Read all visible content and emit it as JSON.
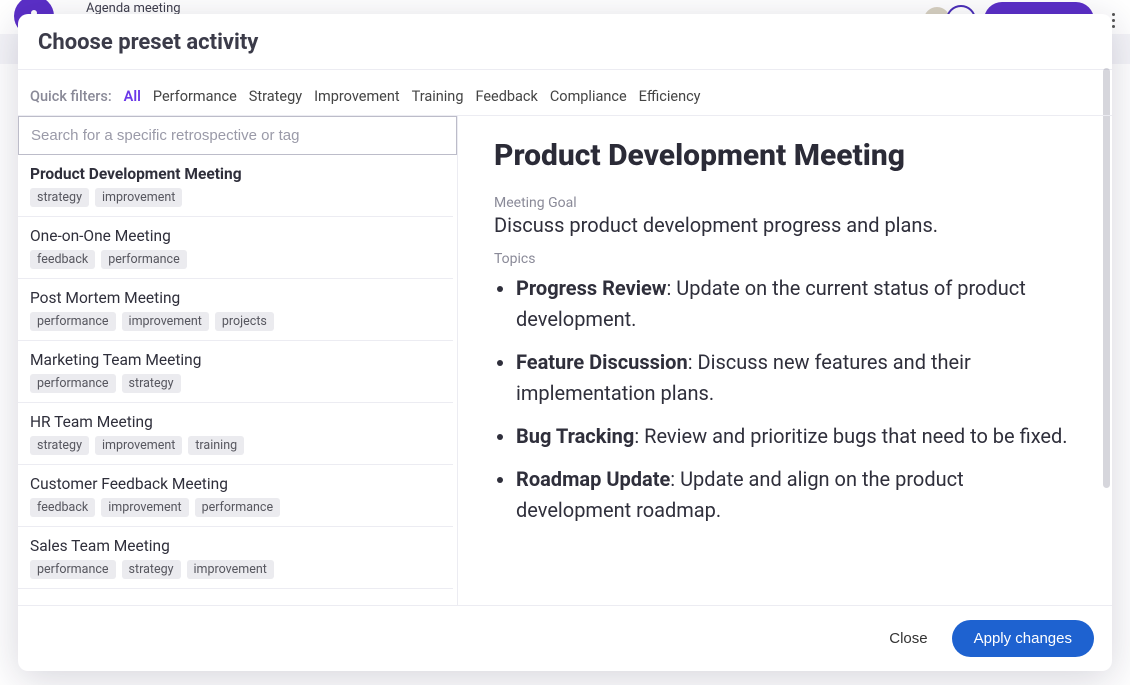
{
  "background": {
    "breadcrumb": "Agenda meeting"
  },
  "modal": {
    "title": "Choose preset activity",
    "filters_label": "Quick filters:",
    "filters": [
      {
        "label": "All",
        "active": true
      },
      {
        "label": "Performance",
        "active": false
      },
      {
        "label": "Strategy",
        "active": false
      },
      {
        "label": "Improvement",
        "active": false
      },
      {
        "label": "Training",
        "active": false
      },
      {
        "label": "Feedback",
        "active": false
      },
      {
        "label": "Compliance",
        "active": false
      },
      {
        "label": "Efficiency",
        "active": false
      }
    ],
    "search_placeholder": "Search for a specific retrospective or tag",
    "presets": [
      {
        "title": "Product Development Meeting",
        "tags": [
          "strategy",
          "improvement"
        ],
        "active": true
      },
      {
        "title": "One-on-One Meeting",
        "tags": [
          "feedback",
          "performance"
        ],
        "active": false
      },
      {
        "title": "Post Mortem Meeting",
        "tags": [
          "performance",
          "improvement",
          "projects"
        ],
        "active": false
      },
      {
        "title": "Marketing Team Meeting",
        "tags": [
          "performance",
          "strategy"
        ],
        "active": false
      },
      {
        "title": "HR Team Meeting",
        "tags": [
          "strategy",
          "improvement",
          "training"
        ],
        "active": false
      },
      {
        "title": "Customer Feedback Meeting",
        "tags": [
          "feedback",
          "improvement",
          "performance"
        ],
        "active": false
      },
      {
        "title": "Sales Team Meeting",
        "tags": [
          "performance",
          "strategy",
          "improvement"
        ],
        "active": false
      }
    ],
    "detail": {
      "title": "Product Development Meeting",
      "goal_label": "Meeting Goal",
      "goal_body": "Discuss product development progress and plans.",
      "topics_label": "Topics",
      "topics": [
        {
          "lead": "Progress Review",
          "rest": ": Update on the current status of product development."
        },
        {
          "lead": "Feature Discussion",
          "rest": ": Discuss new features and their implementation plans."
        },
        {
          "lead": "Bug Tracking",
          "rest": ": Review and prioritize bugs that need to be fixed."
        },
        {
          "lead": "Roadmap Update",
          "rest": ": Update and align on the product development roadmap."
        }
      ]
    },
    "footer": {
      "close": "Close",
      "apply": "Apply changes"
    }
  }
}
